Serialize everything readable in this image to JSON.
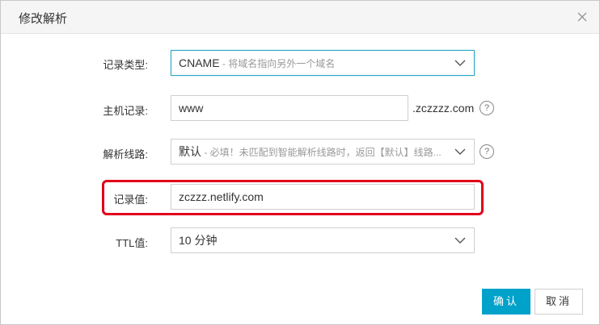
{
  "dialog": {
    "title": "修改解析"
  },
  "form": {
    "record_type": {
      "label": "记录类型:",
      "value": "CNAME",
      "hint": " - 将域名指向另外一个域名"
    },
    "host": {
      "label": "主机记录:",
      "value": "www",
      "suffix": ".zczzzz.com",
      "help": "?"
    },
    "line": {
      "label": "解析线路:",
      "value": "默认",
      "hint": " - 必填！未匹配到智能解析线路时，返回【默认】线路...",
      "help": "?"
    },
    "record_value": {
      "label": "记录值:",
      "value": "zczzz.netlify.com"
    },
    "ttl": {
      "label": "TTL值:",
      "value": "10 分钟"
    }
  },
  "buttons": {
    "confirm": "确认",
    "cancel": "取消"
  },
  "colors": {
    "primary": "#00a2ca",
    "highlight": "#e0001a",
    "active_border": "#29a4c6"
  }
}
